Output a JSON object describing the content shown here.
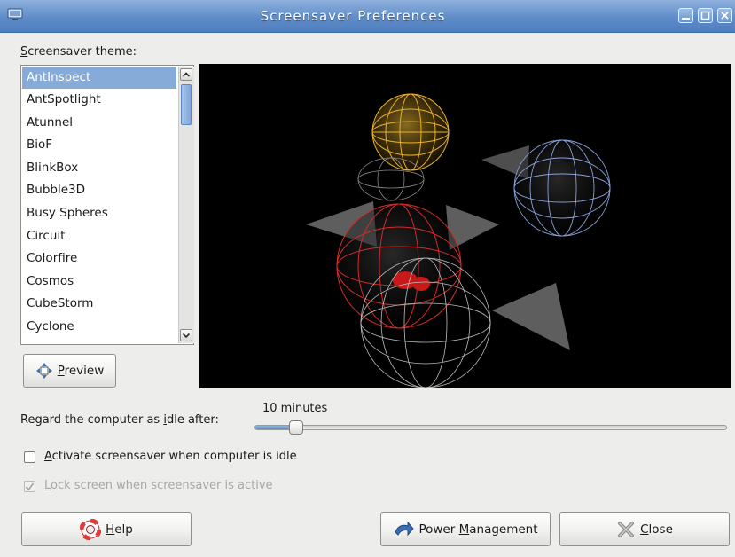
{
  "window": {
    "title": "Screensaver Preferences",
    "icon": "monitor-icon",
    "controls": [
      "minimize-icon",
      "maximize-icon",
      "close-icon"
    ]
  },
  "theme_section": {
    "label_mnemonic": "S",
    "label_rest": "creensaver theme:",
    "items": [
      "AntInspect",
      "AntSpotlight",
      "Atunnel",
      "BioF",
      "BlinkBox",
      "Bubble3D",
      "Busy Spheres",
      "Circuit",
      "Colorfire",
      "Cosmos",
      "CubeStorm",
      "Cyclone"
    ],
    "selected": "AntInspect"
  },
  "preview_button": {
    "mnemonic": "P",
    "rest": "review",
    "icon": "move-arrows-icon"
  },
  "idle": {
    "label_before": "Regard the computer as ",
    "label_mnemonic": "i",
    "label_after": "dle after:",
    "value_text": "10 minutes",
    "slider_fraction": 0.08
  },
  "activate_check": {
    "mnemonic": "A",
    "rest": "ctivate screensaver when computer is idle",
    "checked": false
  },
  "lock_check": {
    "mnemonic": "L",
    "rest": "ock screen when screensaver is active",
    "checked": true,
    "disabled": true
  },
  "buttons": {
    "help": {
      "mnemonic": "H",
      "rest": "elp",
      "icon": "lifebuoy-icon"
    },
    "power": {
      "before": "Power ",
      "mnemonic": "M",
      "rest": "anagement",
      "icon": "power-arrow-icon"
    },
    "close": {
      "mnemonic": "C",
      "rest": "lose",
      "icon": "close-x-icon"
    }
  },
  "colors": {
    "titlebar": "#5f8cc9",
    "selection": "#86abd9",
    "preview_bg": "#000000"
  }
}
